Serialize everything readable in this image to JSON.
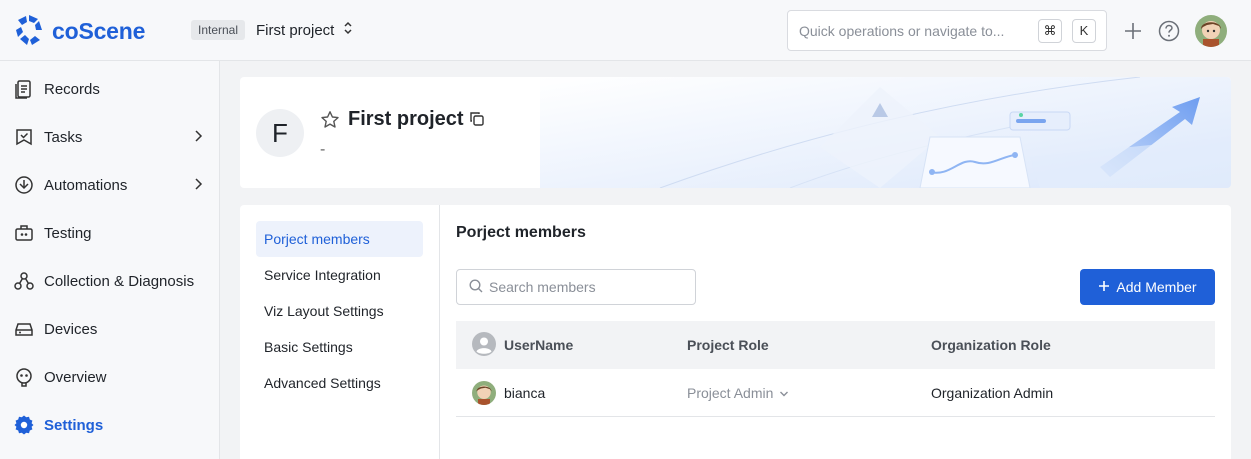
{
  "app": {
    "logo_text": "coScene",
    "brand_color": "#1f60d8"
  },
  "topbar": {
    "org_badge": "Internal",
    "project_name": "First project",
    "search_placeholder": "Quick operations or navigate to...",
    "shortcut_keys": [
      "⌘",
      "K"
    ]
  },
  "sidebar": {
    "items": [
      {
        "label": "Records",
        "icon": "records-icon",
        "has_children": false
      },
      {
        "label": "Tasks",
        "icon": "tasks-icon",
        "has_children": true
      },
      {
        "label": "Automations",
        "icon": "automations-icon",
        "has_children": true
      },
      {
        "label": "Testing",
        "icon": "testing-icon",
        "has_children": false
      },
      {
        "label": "Collection & Diagnosis",
        "icon": "diagnosis-icon",
        "has_children": false
      },
      {
        "label": "Devices",
        "icon": "devices-icon",
        "has_children": false
      },
      {
        "label": "Overview",
        "icon": "overview-icon",
        "has_children": false
      },
      {
        "label": "Settings",
        "icon": "gear-icon",
        "has_children": false,
        "active": true
      }
    ]
  },
  "banner": {
    "avatar_letter": "F",
    "title": "First project",
    "description": "-"
  },
  "settings": {
    "menu": [
      {
        "label": "Porject members",
        "active": true
      },
      {
        "label": "Service Integration"
      },
      {
        "label": "Viz Layout Settings"
      },
      {
        "label": "Basic Settings"
      },
      {
        "label": "Advanced Settings"
      }
    ],
    "panel_title": "Porject members",
    "search_placeholder": "Search members",
    "add_button": "Add Member",
    "table": {
      "columns": [
        "UserName",
        "Project Role",
        "Organization Role"
      ],
      "rows": [
        {
          "username": "bianca",
          "project_role": "Project Admin",
          "organization_role": "Organization Admin"
        }
      ]
    }
  }
}
